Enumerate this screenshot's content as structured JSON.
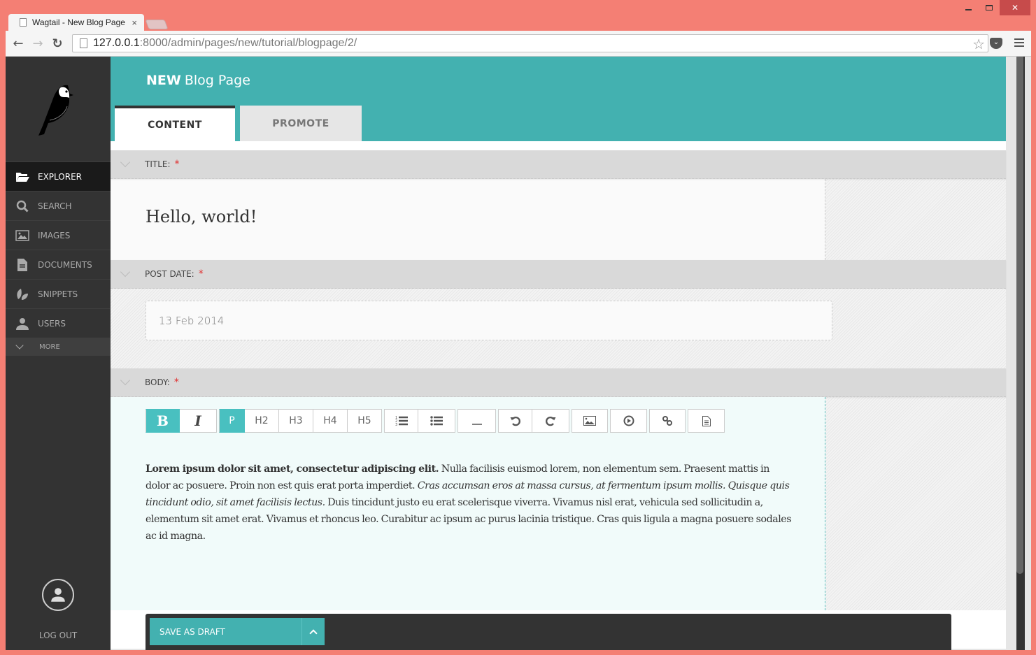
{
  "browser": {
    "tab_title": "Wagtail - New Blog Page",
    "tab_close": "×",
    "url_host": "127.0.0.1",
    "url_rest": ":8000/admin/pages/new/tutorial/blogpage/2/",
    "back_icon": "←",
    "forward_icon": "→",
    "reload_icon": "↻",
    "star_icon": "☆",
    "window_close": "✕"
  },
  "sidebar": {
    "items": [
      {
        "label": "EXPLORER",
        "icon": "folder-open-icon",
        "active": true
      },
      {
        "label": "SEARCH",
        "icon": "search-icon"
      },
      {
        "label": "IMAGES",
        "icon": "image-icon"
      },
      {
        "label": "DOCUMENTS",
        "icon": "document-icon"
      },
      {
        "label": "SNIPPETS",
        "icon": "snippet-leaf-icon"
      },
      {
        "label": "USERS",
        "icon": "user-icon"
      }
    ],
    "more_label": "MORE",
    "logout_label": "LOG OUT"
  },
  "header": {
    "title_prefix": "NEW",
    "title": "Blog Page",
    "tabs": [
      {
        "label": "CONTENT",
        "active": true
      },
      {
        "label": "PROMOTE",
        "active": false
      }
    ]
  },
  "fields": {
    "title": {
      "label": "TITLE:",
      "required": "*",
      "value": "Hello, world!"
    },
    "post_date": {
      "label": "POST DATE:",
      "required": "*",
      "value": "13 Feb 2014"
    },
    "body": {
      "label": "BODY:",
      "required": "*",
      "toolbar": {
        "bold": "B",
        "italic": "I",
        "p": "P",
        "h2": "H2",
        "h3": "H3",
        "h4": "H4",
        "h5": "H5",
        "hr": "—"
      },
      "text": {
        "bold": "Lorem ipsum dolor sit amet, consectetur adipiscing elit.",
        "part1": " Nulla facilisis euismod lorem, non elementum sem. Praesent mattis in dolor ac posuere. Proin non est quis erat porta imperdiet. ",
        "italic": "Cras accumsan eros at massa cursus, at fermentum ipsum mollis. Quisque quis tincidunt odio, sit amet facilisis lectus.",
        "part2": " Duis tincidunt justo eu erat scelerisque viverra. Vivamus nisl erat, vehicula sed sollicitudin a, elementum sit amet erat. Vivamus et rhoncus leo. Curabitur ac ipsum ac purus lacinia tristique. Cras quis ligula a magna posuere sodales ac id magna."
      }
    }
  },
  "actions": {
    "save_draft_label": "SAVE AS DRAFT"
  },
  "colors": {
    "accent": "#43b1b0",
    "sidebar_bg": "#333333",
    "required": "#e03131"
  }
}
